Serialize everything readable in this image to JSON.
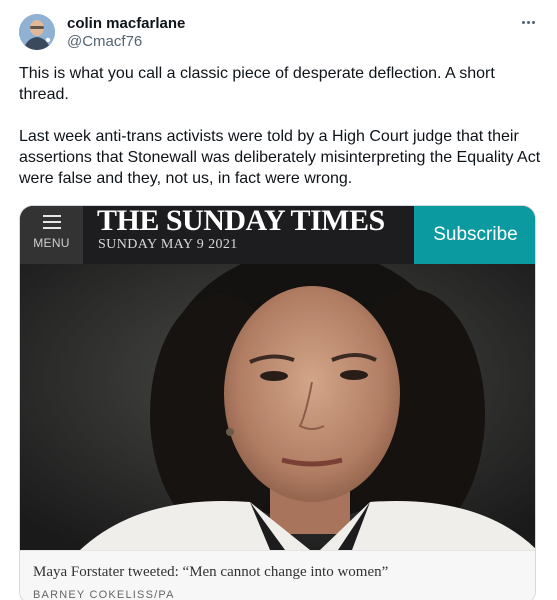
{
  "author": {
    "display_name": "colin macfarlane",
    "handle": "@Cmacf76"
  },
  "tweet": {
    "paragraphs": [
      "This is what you call a classic piece of desperate deflection. A short thread.",
      "Last week anti-trans activists were told by a High Court judge that their assertions that Stonewall was deliberately misinterpreting the Equality Act were false and they, not us, in fact were wrong."
    ]
  },
  "card": {
    "masthead": {
      "menu_label": "MENU",
      "title": "THE SUNDAY TIMES",
      "date": "SUNDAY MAY 9 2021",
      "subscribe_label": "Subscribe"
    },
    "caption": "Maya Forstater tweeted: “Men cannot change into women”",
    "credit": "BARNEY COKELISS/PA"
  },
  "icons": {
    "more": "more-horizontal-icon",
    "menu": "hamburger-menu-icon"
  },
  "colors": {
    "text": "#0f1419",
    "secondary_text": "#536471",
    "masthead_bg": "#1d1d1f",
    "subscribe_bg": "#0b9aa0"
  }
}
